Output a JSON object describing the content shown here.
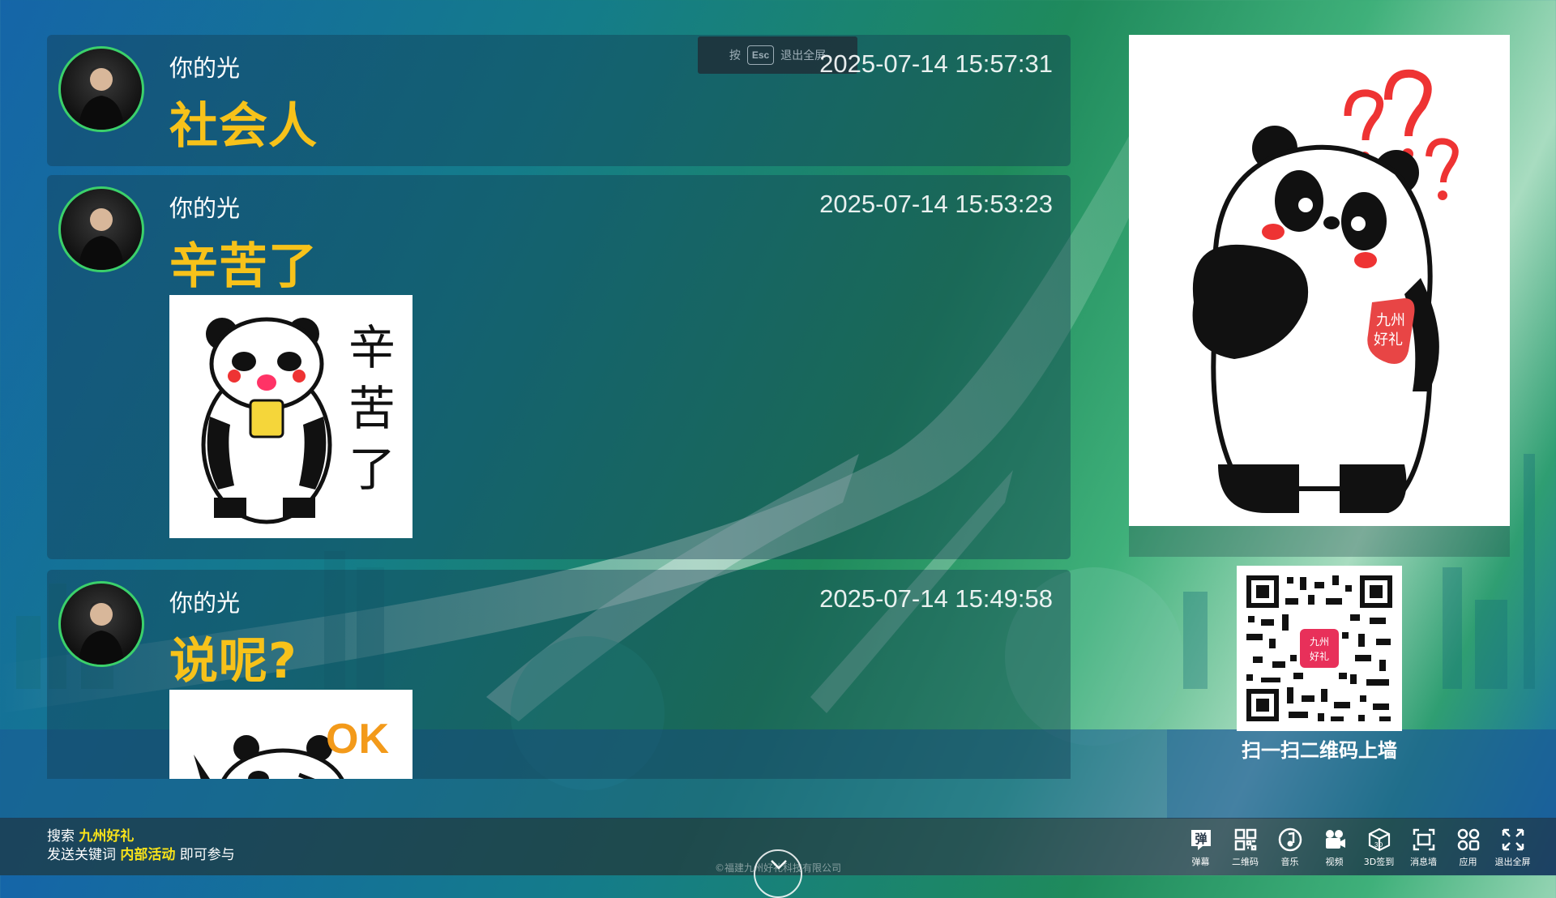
{
  "esc_hint": {
    "prefix": "按",
    "key": "Esc",
    "suffix": "退出全屏"
  },
  "messages": [
    {
      "name": "你的光",
      "time": "2025-07-14 15:57:31",
      "text": "社会人"
    },
    {
      "name": "你的光",
      "time": "2025-07-14 15:53:23",
      "text": "辛苦了",
      "sticker_text": [
        "辛",
        "苦",
        "了"
      ]
    },
    {
      "name": "你的光",
      "time": "2025-07-14 15:49:58",
      "text": "说呢?",
      "sticker_text": [
        "OK"
      ]
    }
  ],
  "side_image": {
    "badge_text": [
      "九州",
      "好礼"
    ]
  },
  "qr": {
    "caption": "扫一扫二维码上墙",
    "logo_text": [
      "九州",
      "好礼"
    ]
  },
  "promo": {
    "line1_prefix": "搜索 ",
    "line1_highlight": "九州好礼",
    "line2_prefix": "发送关键词 ",
    "line2_highlight": "内部活动",
    "line2_suffix": " 即可参与"
  },
  "toolbar": [
    {
      "label": "弹幕",
      "icon": "danmaku-icon"
    },
    {
      "label": "二维码",
      "icon": "qrcode-icon"
    },
    {
      "label": "音乐",
      "icon": "music-icon"
    },
    {
      "label": "视频",
      "icon": "video-icon"
    },
    {
      "label": "3D签到",
      "icon": "cube-icon"
    },
    {
      "label": "消息墙",
      "icon": "message-wall-icon"
    },
    {
      "label": "应用",
      "icon": "apps-icon"
    },
    {
      "label": "退出全屏",
      "icon": "exit-fullscreen-icon"
    }
  ],
  "copyright": "©福建九州好礼科技有限公司",
  "colors": {
    "name": "#ffffff",
    "text": "#f7c21a",
    "avatar_ring": "#3bd16b",
    "highlight": "#f7e21a"
  }
}
